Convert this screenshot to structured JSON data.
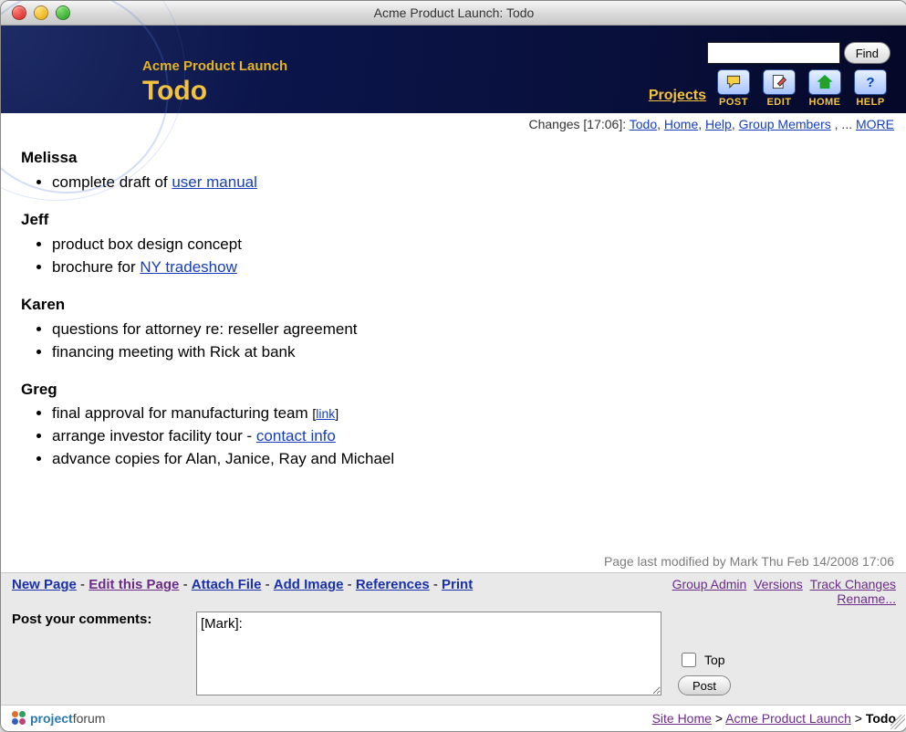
{
  "window": {
    "title": "Acme Product Launch: Todo"
  },
  "header": {
    "project": "Acme Product Launch",
    "page": "Todo",
    "projects_link": "Projects",
    "search": {
      "find": "Find"
    },
    "toolbar": {
      "post": "POST",
      "edit": "EDIT",
      "home": "HOME",
      "help": "HELP"
    }
  },
  "changes": {
    "prefix": "Changes [17:06]: ",
    "links": [
      "Todo",
      "Home",
      "Help",
      "Group Members"
    ],
    "ellipsis": ", ... ",
    "more": "MORE"
  },
  "sections": [
    {
      "name": "Melissa",
      "items": [
        {
          "parts": [
            {
              "t": "complete draft of "
            },
            {
              "t": "user manual",
              "href": true
            }
          ]
        }
      ]
    },
    {
      "name": "Jeff",
      "items": [
        {
          "parts": [
            {
              "t": "product box design concept"
            }
          ]
        },
        {
          "parts": [
            {
              "t": "brochure for "
            },
            {
              "t": "NY tradeshow",
              "href": true
            }
          ]
        }
      ]
    },
    {
      "name": "Karen",
      "items": [
        {
          "parts": [
            {
              "t": "questions for attorney re: reseller agreement"
            }
          ]
        },
        {
          "parts": [
            {
              "t": "financing meeting with Rick at bank"
            }
          ]
        }
      ]
    },
    {
      "name": "Greg",
      "items": [
        {
          "parts": [
            {
              "t": "final approval for manufacturing team "
            },
            {
              "t": "[",
              "small": true
            },
            {
              "t": "link",
              "href": true,
              "small": true
            },
            {
              "t": "]",
              "small": true
            }
          ]
        },
        {
          "parts": [
            {
              "t": "arrange investor facility tour - "
            },
            {
              "t": "contact info",
              "href": true
            }
          ]
        },
        {
          "parts": [
            {
              "t": "advance copies for Alan, Janice, Ray and Michael"
            }
          ]
        }
      ]
    }
  ],
  "last_modified": "Page last modified by Mark Thu Feb 14/2008 17:06",
  "actions": {
    "left": [
      {
        "label": "New Page",
        "visited": false
      },
      {
        "label": "Edit this Page",
        "visited": true
      },
      {
        "label": "Attach File",
        "visited": false
      },
      {
        "label": "Add Image",
        "visited": false
      },
      {
        "label": "References",
        "visited": false
      },
      {
        "label": "Print",
        "visited": false
      }
    ],
    "right": [
      {
        "label": "Group Admin"
      },
      {
        "label": "Versions"
      },
      {
        "label": "Track Changes"
      },
      {
        "label": "Rename...",
        "newline": true
      }
    ],
    "sep": " - "
  },
  "comment": {
    "prompt": "Post your comments:",
    "value": "[Mark]:",
    "top": "Top",
    "post": "Post"
  },
  "footer": {
    "brand_a": "project",
    "brand_b": "forum",
    "bc": {
      "site": "Site Home",
      "proj": "Acme Product Launch",
      "here": "Todo",
      "sep": " > "
    }
  }
}
